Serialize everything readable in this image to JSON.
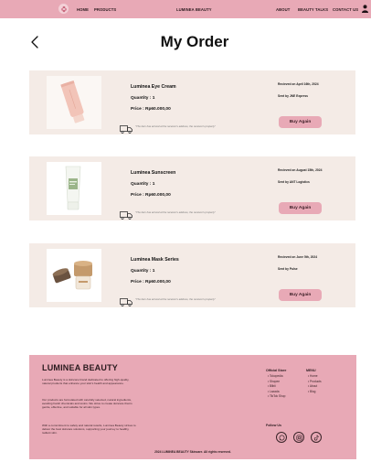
{
  "nav": {
    "home": "HOME",
    "products": "PRODUCTS",
    "brand": "LUMINEA BEAUTY",
    "about": "ABOUT",
    "beauty_talks": "BEAUTY TALKS",
    "contact": "CONTACT US",
    "user_icon": "user-icon",
    "logo_icon": "flower-logo-icon"
  },
  "header": {
    "back_icon": "chevron-left-icon",
    "title": "My Order"
  },
  "orders": [
    {
      "name": "Luminea Eye Cream",
      "quantity": "Quantity : 1",
      "price": "Price : Rp60.000,00",
      "received": "Recieved on April 16th, 2024",
      "sent_by": "Sent by JNE Express",
      "tracking": "\"The item has arrived at the receiver's address, the receiver's property\"",
      "button": "Buy Again",
      "image_icon": "eye-cream-tube-image"
    },
    {
      "name": "Luminea Sunscreen",
      "quantity": "Quantity : 1",
      "price": "Price : Rp60.000,00",
      "received": "Recieved on August 15th, 2024",
      "sent_by": "Sent by ANT Logistics",
      "tracking": "\"The item has arrived at the receiver's address, the receiver's property\"",
      "button": "Buy Again",
      "image_icon": "sunscreen-tube-image"
    },
    {
      "name": "Luminea Mask Series",
      "quantity": "Quantity : 1",
      "price": "Price : Rp60.000,00",
      "received": "Recieved on June 5th, 2024",
      "sent_by": "Sent by Pulse",
      "tracking": "\"The item has arrived at the receiver's address, the receiver's property\"",
      "button": "Buy Again",
      "image_icon": "mask-jars-image"
    }
  ],
  "footer": {
    "brand": "LUMINEA BEAUTY",
    "para1": "Luminea Beauty is a skincare brand dedicated to offering high-quality, natural products that enhance your skin's health and appearance.",
    "para2": "Our products are formulated with carefully selected, natural ingredients, avoiding harsh chemicals and toxins. We strive to create skincare that is gentle, effective, and suitable for all skin types.",
    "para3": "With a commitment to safety and natural results, Luminea Beauty strives to deliver the best skincare solutions, supporting your journey to healthy, radiant skin.",
    "official_store": "Official Store",
    "stores": [
      "Tokopedia",
      "Shopee",
      "Blibli",
      "Lazada",
      "TikTok Shop"
    ],
    "menu": "MENU",
    "menu_items": [
      "Home",
      "Products",
      "About",
      "Blog"
    ],
    "follow_us": "Follow Us",
    "socials": [
      "whatsapp-icon",
      "instagram-icon",
      "tiktok-icon"
    ],
    "copyright": "2024 LUMINEA BEAUTY Skincare. All rights reserved."
  },
  "colors": {
    "accent_pink": "#e8a9b6",
    "card_background": "#f4ebe6"
  }
}
